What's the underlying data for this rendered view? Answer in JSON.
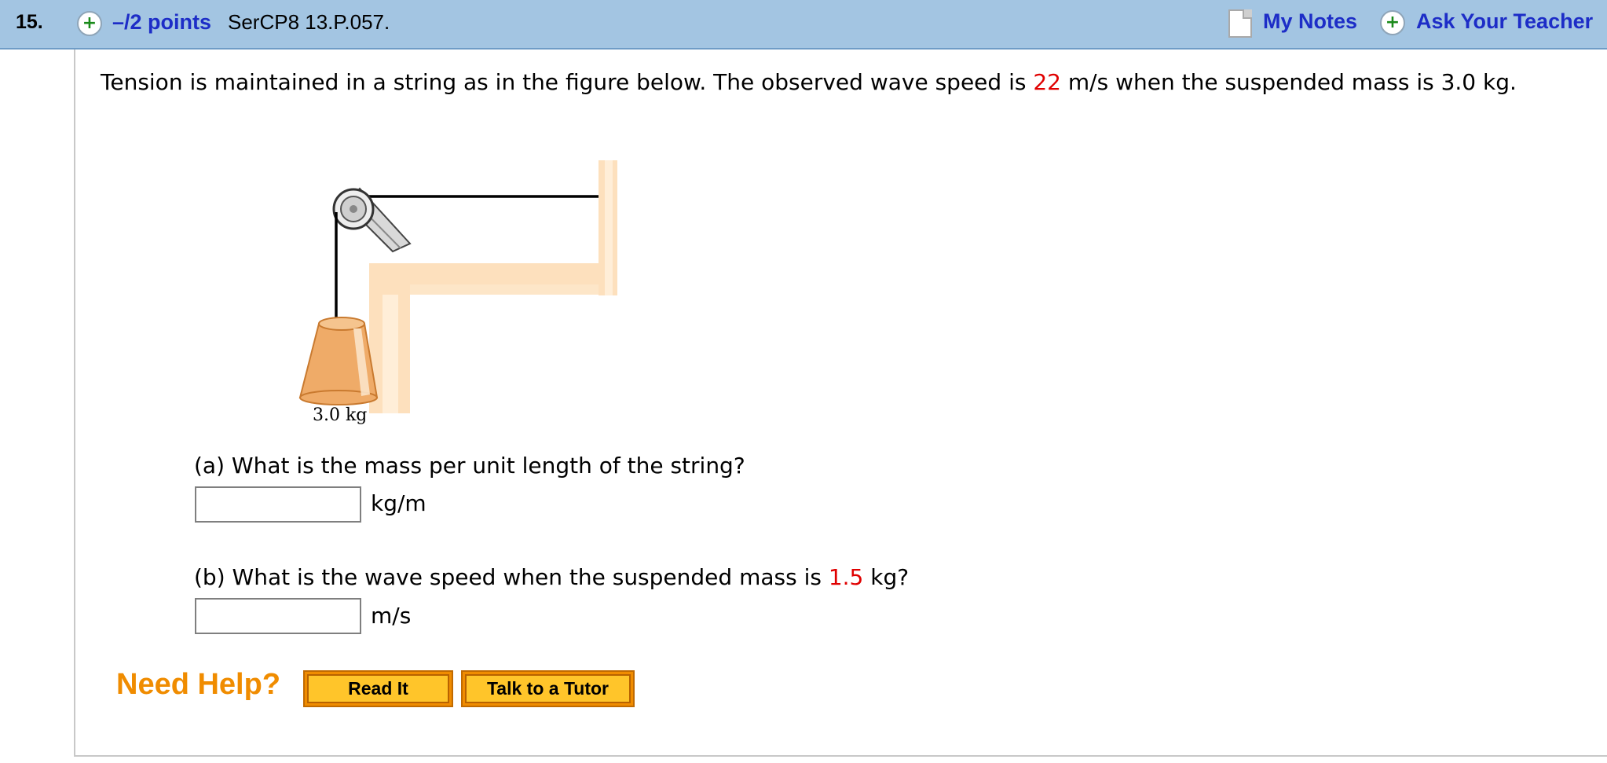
{
  "header": {
    "question_number": "15.",
    "points": "–/2 points",
    "question_code": "SerCP8 13.P.057.",
    "my_notes": "My Notes",
    "ask_teacher": "Ask Your Teacher"
  },
  "problem": {
    "intro_before_speed": "Tension is maintained in a string as in the figure below. The observed wave speed is ",
    "wave_speed": "22",
    "intro_after_speed": " m/s when the suspended mass is 3.0 kg.",
    "figure_label": "3.0 kg"
  },
  "part_a": {
    "question": "(a) What is the mass per unit length of the string?",
    "answer_value": "",
    "unit": "kg/m"
  },
  "part_b": {
    "question_before": "(b) What is the wave speed when the suspended mass is ",
    "mass": "1.5",
    "question_after": " kg?",
    "answer_value": "",
    "unit": "m/s"
  },
  "help": {
    "title": "Need Help?",
    "read_it": "Read It",
    "tutor": "Talk to a Tutor"
  },
  "colors": {
    "header_bg": "#a3c5e2",
    "link": "#1d2dc7",
    "highlight": "#e00000",
    "help_orange": "#f08c00",
    "help_button": "#ffc52a"
  }
}
